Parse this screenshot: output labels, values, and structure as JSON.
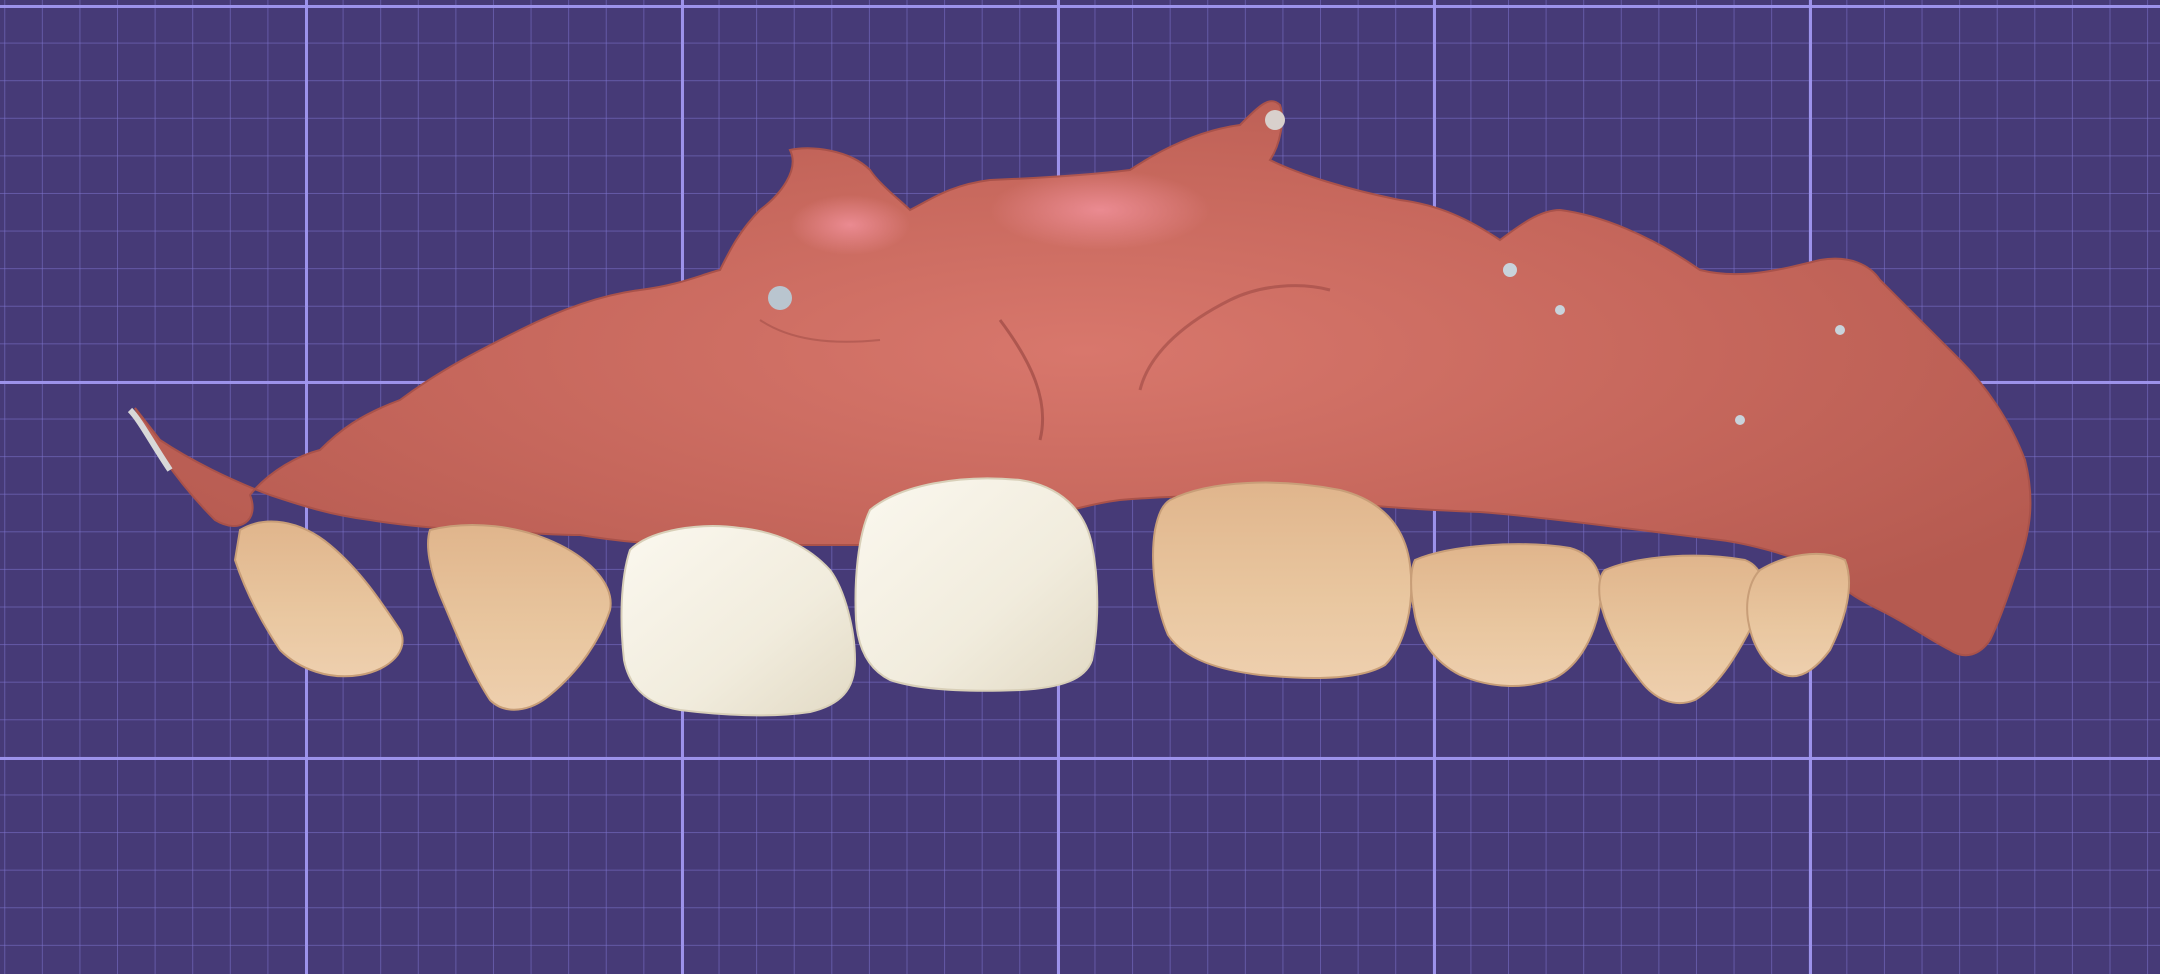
{
  "scene": {
    "subject": "dental-arch-3d-scan",
    "colors": {
      "background": "#463a77",
      "grid_major": "#a096f0",
      "grid_minor": "#7d73cd",
      "gingiva": "#c96a5e",
      "gingiva_highlight": "#e88a8c",
      "natural_tooth": "#e8c9a2",
      "crown": "#f3efe3"
    },
    "teeth": [
      {
        "name": "natural-tooth",
        "type": "natural"
      },
      {
        "name": "natural-tooth",
        "type": "natural"
      },
      {
        "name": "crown",
        "type": "restoration"
      },
      {
        "name": "crown",
        "type": "restoration"
      },
      {
        "name": "natural-tooth",
        "type": "natural"
      },
      {
        "name": "natural-tooth",
        "type": "natural"
      },
      {
        "name": "natural-tooth",
        "type": "natural"
      },
      {
        "name": "natural-tooth",
        "type": "natural"
      }
    ]
  }
}
